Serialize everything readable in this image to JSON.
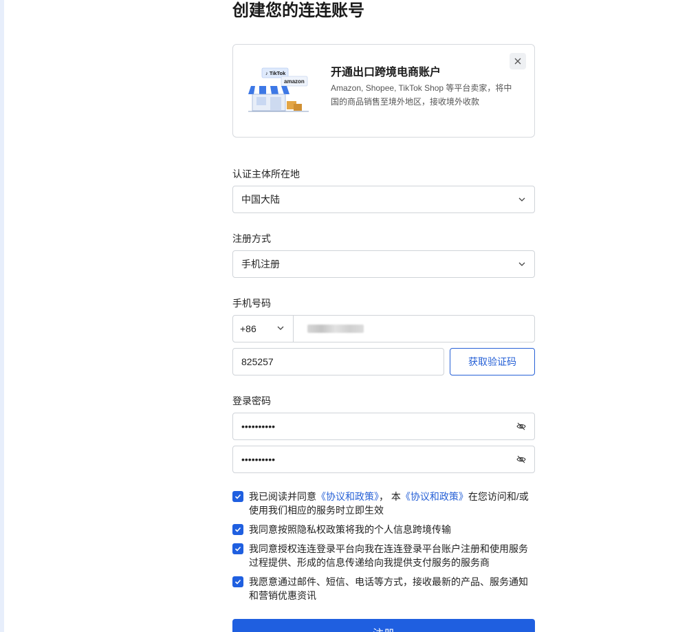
{
  "page": {
    "title": "创建您的连连账号"
  },
  "promo": {
    "title": "开通出口跨境电商账户",
    "description": "Amazon, Shopee, TikTok Shop 等平台卖家，将中国的商品销售至境外地区，接收境外收款",
    "badge_tiktok": "TikTok",
    "badge_amazon": "amazon"
  },
  "form": {
    "location": {
      "label": "认证主体所在地",
      "value": "中国大陆"
    },
    "method": {
      "label": "注册方式",
      "value": "手机注册"
    },
    "phone": {
      "label": "手机号码",
      "country_code": "+86"
    },
    "code": {
      "value": "825257",
      "button": "获取验证码"
    },
    "password": {
      "label": "登录密码",
      "value1": "••••••••••",
      "value2": "••••••••••"
    }
  },
  "agreements": {
    "a1_pre": "我已阅读并同意",
    "a1_link1": "《协议和政策》",
    "a1_mid": "， 本",
    "a1_link2": "《协议和政策》",
    "a1_post": "在您访问和/或使用我们相应的服务时立即生效",
    "a2": "我同意按照隐私权政策将我的个人信息跨境传输",
    "a3": "我同意授权连连登录平台向我在连连登录平台账户注册和使用服务过程提供、形成的信息传递给向我提供支付服务的服务商",
    "a4": "我愿意通过邮件、短信、电话等方式，接收最新的产品、服务通知和营销优惠资讯"
  },
  "submit": {
    "label": "注册"
  },
  "colors": {
    "primary": "#1f5fe0",
    "link": "#2660d6",
    "border": "#cfd3d8"
  }
}
